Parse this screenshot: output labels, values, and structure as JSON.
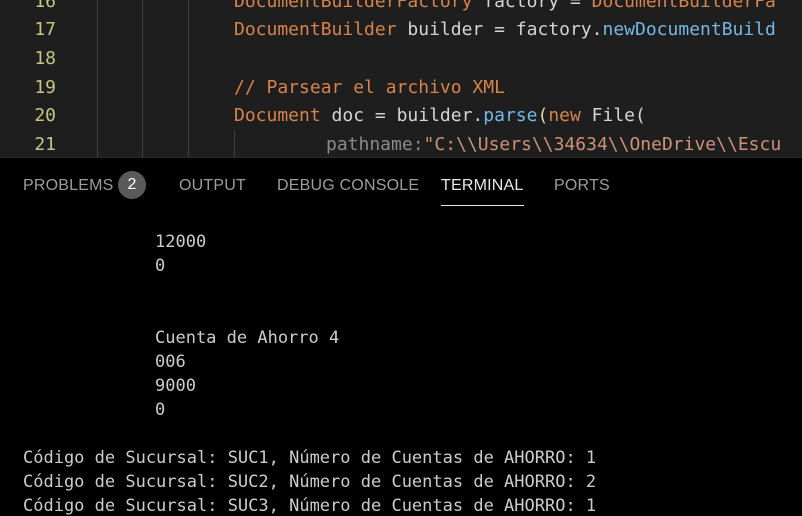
{
  "editor": {
    "lines": [
      {
        "no": "16",
        "parts": [
          {
            "t": "DocumentBuilderFactory",
            "c": "tok-type"
          },
          {
            "t": " factory ",
            "c": "tok-var"
          },
          {
            "t": "=",
            "c": "tok-op"
          },
          {
            "t": " DocumentBuilderFa",
            "c": "tok-type"
          }
        ]
      },
      {
        "no": "17",
        "parts": [
          {
            "t": "DocumentBuilder",
            "c": "tok-type"
          },
          {
            "t": " builder ",
            "c": "tok-var"
          },
          {
            "t": "=",
            "c": "tok-op"
          },
          {
            "t": " factory.",
            "c": "tok-var"
          },
          {
            "t": "newDocumentBuild",
            "c": "tok-method"
          }
        ]
      },
      {
        "no": "18",
        "parts": []
      },
      {
        "no": "19",
        "parts": [
          {
            "t": "// Parsear el archivo XML",
            "c": "tok-comment"
          }
        ]
      },
      {
        "no": "20",
        "parts": [
          {
            "t": "Document",
            "c": "tok-type"
          },
          {
            "t": " doc ",
            "c": "tok-var"
          },
          {
            "t": "=",
            "c": "tok-op"
          },
          {
            "t": " builder.",
            "c": "tok-var"
          },
          {
            "t": "parse",
            "c": "tok-method"
          },
          {
            "t": "(",
            "c": "tok-fn"
          },
          {
            "t": "new",
            "c": "tok-new"
          },
          {
            "t": " File(",
            "c": "tok-var"
          }
        ]
      },
      {
        "no": "21",
        "indent": true,
        "parts": [
          {
            "t": "pathname:",
            "c": "tok-hint"
          },
          {
            "t": "\"C:\\\\Users\\\\34634\\\\OneDrive\\\\Escu",
            "c": "tok-str"
          }
        ]
      }
    ]
  },
  "panel": {
    "tabs": [
      {
        "label": "PROBLEMS",
        "active": false
      },
      {
        "label": "OUTPUT",
        "active": false
      },
      {
        "label": "DEBUG CONSOLE",
        "active": false
      },
      {
        "label": "TERMINAL",
        "active": true
      },
      {
        "label": "PORTS",
        "active": false
      }
    ],
    "problems_count": "2"
  },
  "terminal": {
    "lines": [
      {
        "text": "12000",
        "indent": true
      },
      {
        "text": "0",
        "indent": true
      },
      {
        "text": "",
        "indent": true
      },
      {
        "text": "",
        "indent": true
      },
      {
        "text": "Cuenta de Ahorro 4",
        "indent": true
      },
      {
        "text": "006",
        "indent": true
      },
      {
        "text": "9000",
        "indent": true
      },
      {
        "text": "0",
        "indent": true
      },
      {
        "text": "",
        "indent": false
      },
      {
        "text": "Código de Sucursal: SUC1, Número de Cuentas de AHORRO: 1",
        "indent": false
      },
      {
        "text": "Código de Sucursal: SUC2, Número de Cuentas de AHORRO: 2",
        "indent": false
      },
      {
        "text": "Código de Sucursal: SUC3, Número de Cuentas de AHORRO: 1",
        "indent": false
      }
    ]
  }
}
